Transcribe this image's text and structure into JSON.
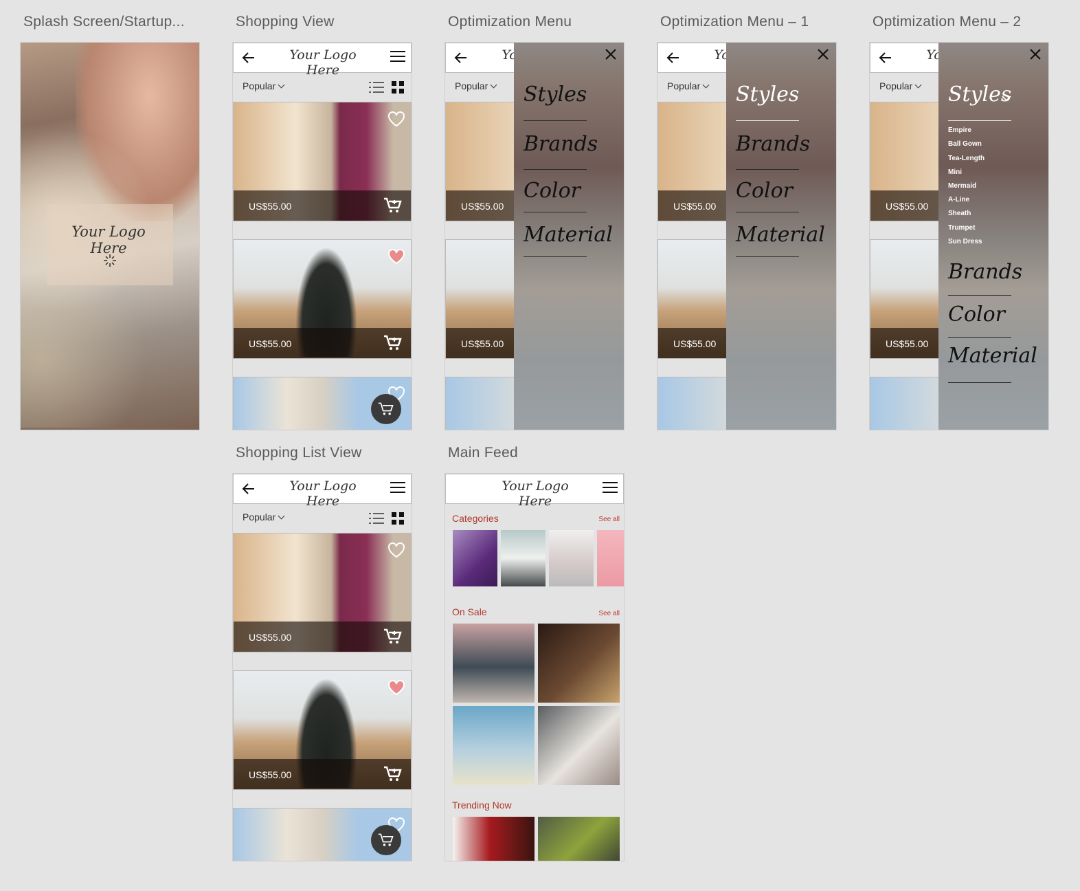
{
  "boards": {
    "splash": "Splash Screen/Startup...",
    "shopping": "Shopping View",
    "opt": "Optimization Menu",
    "opt1": "Optimization Menu – 1",
    "opt2": "Optimization Menu – 2",
    "list": "Shopping List View",
    "feed": "Main Feed"
  },
  "logo": "Your Logo Here",
  "sort": "Popular",
  "price": "US$55.00",
  "menu": {
    "styles": "Styles",
    "brands": "Brands",
    "color": "Color",
    "material": "Material",
    "sub_styles": [
      "Empire",
      "Ball Gown",
      "Tea-Length",
      "Mini",
      "Mermaid",
      "A-Line",
      "Sheath",
      "Trumpet",
      "Sun Dress"
    ]
  },
  "feed": {
    "categories": "Categories",
    "on_sale": "On Sale",
    "trending": "Trending Now",
    "see_all": "See all"
  },
  "colors": {
    "accent": "#b03a2e",
    "fav": "#e98b8b"
  }
}
